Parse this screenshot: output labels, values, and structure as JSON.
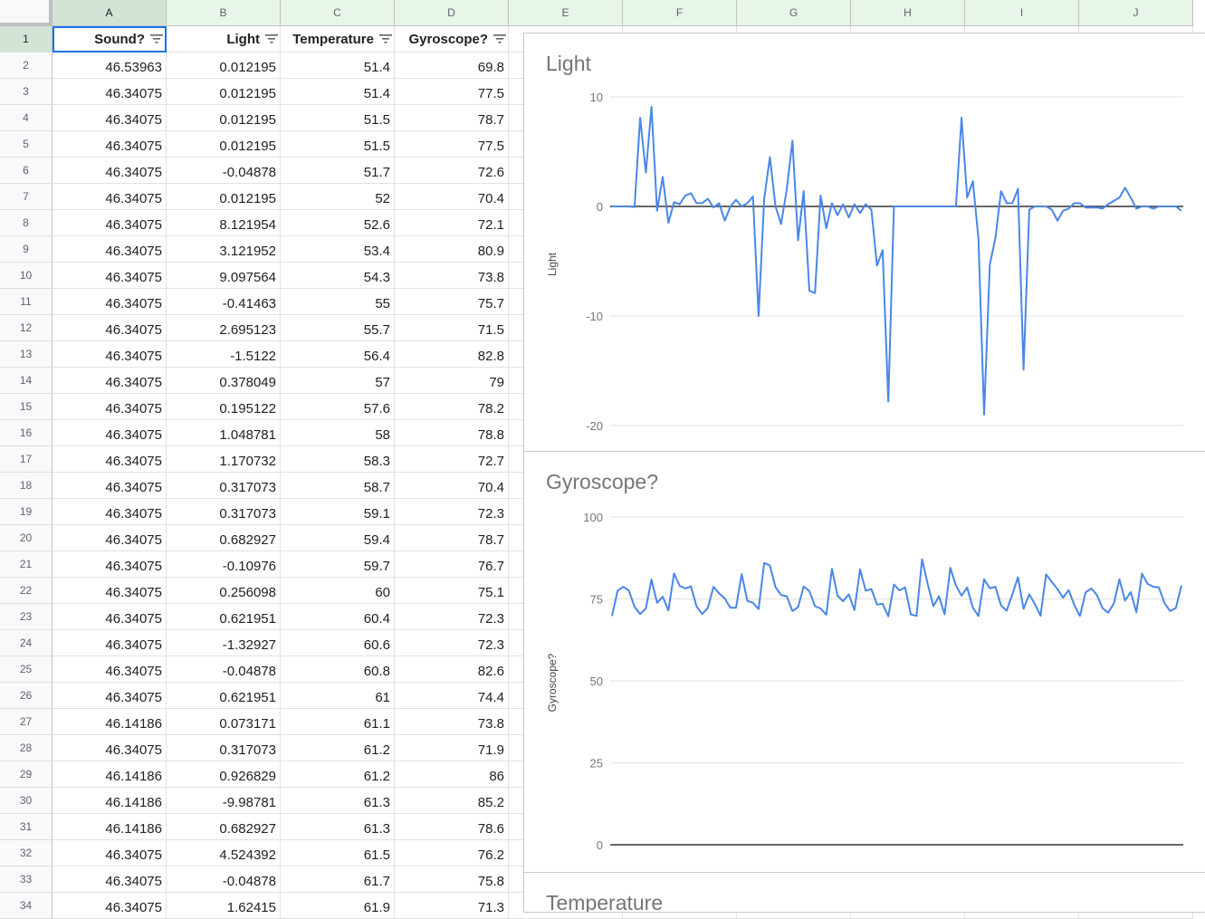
{
  "columns": [
    "A",
    "B",
    "C",
    "D",
    "E",
    "F",
    "G",
    "H",
    "I",
    "J"
  ],
  "headers": {
    "A": "Sound?",
    "B": "Light",
    "C": "Temperature",
    "D": "Gyroscope?"
  },
  "rows": [
    {
      "n": "1"
    },
    {
      "n": "2",
      "a": "46.53963",
      "b": "0.012195",
      "c": "51.4",
      "d": "69.8"
    },
    {
      "n": "3",
      "a": "46.34075",
      "b": "0.012195",
      "c": "51.4",
      "d": "77.5"
    },
    {
      "n": "4",
      "a": "46.34075",
      "b": "0.012195",
      "c": "51.5",
      "d": "78.7"
    },
    {
      "n": "5",
      "a": "46.34075",
      "b": "0.012195",
      "c": "51.5",
      "d": "77.5"
    },
    {
      "n": "6",
      "a": "46.34075",
      "b": "-0.04878",
      "c": "51.7",
      "d": "72.6"
    },
    {
      "n": "7",
      "a": "46.34075",
      "b": "0.012195",
      "c": "52",
      "d": "70.4"
    },
    {
      "n": "8",
      "a": "46.34075",
      "b": "8.121954",
      "c": "52.6",
      "d": "72.1"
    },
    {
      "n": "9",
      "a": "46.34075",
      "b": "3.121952",
      "c": "53.4",
      "d": "80.9"
    },
    {
      "n": "10",
      "a": "46.34075",
      "b": "9.097564",
      "c": "54.3",
      "d": "73.8"
    },
    {
      "n": "11",
      "a": "46.34075",
      "b": "-0.41463",
      "c": "55",
      "d": "75.7"
    },
    {
      "n": "12",
      "a": "46.34075",
      "b": "2.695123",
      "c": "55.7",
      "d": "71.5"
    },
    {
      "n": "13",
      "a": "46.34075",
      "b": "-1.5122",
      "c": "56.4",
      "d": "82.8"
    },
    {
      "n": "14",
      "a": "46.34075",
      "b": "0.378049",
      "c": "57",
      "d": "79"
    },
    {
      "n": "15",
      "a": "46.34075",
      "b": "0.195122",
      "c": "57.6",
      "d": "78.2"
    },
    {
      "n": "16",
      "a": "46.34075",
      "b": "1.048781",
      "c": "58",
      "d": "78.8"
    },
    {
      "n": "17",
      "a": "46.34075",
      "b": "1.170732",
      "c": "58.3",
      "d": "72.7"
    },
    {
      "n": "18",
      "a": "46.34075",
      "b": "0.317073",
      "c": "58.7",
      "d": "70.4"
    },
    {
      "n": "19",
      "a": "46.34075",
      "b": "0.317073",
      "c": "59.1",
      "d": "72.3"
    },
    {
      "n": "20",
      "a": "46.34075",
      "b": "0.682927",
      "c": "59.4",
      "d": "78.7"
    },
    {
      "n": "21",
      "a": "46.34075",
      "b": "-0.10976",
      "c": "59.7",
      "d": "76.7"
    },
    {
      "n": "22",
      "a": "46.34075",
      "b": "0.256098",
      "c": "60",
      "d": "75.1"
    },
    {
      "n": "23",
      "a": "46.34075",
      "b": "0.621951",
      "c": "60.4",
      "d": "72.3"
    },
    {
      "n": "24",
      "a": "46.34075",
      "b": "-1.32927",
      "c": "60.6",
      "d": "72.3"
    },
    {
      "n": "25",
      "a": "46.34075",
      "b": "-0.04878",
      "c": "60.8",
      "d": "82.6"
    },
    {
      "n": "26",
      "a": "46.34075",
      "b": "0.621951",
      "c": "61",
      "d": "74.4"
    },
    {
      "n": "27",
      "a": "46.14186",
      "b": "0.073171",
      "c": "61.1",
      "d": "73.8"
    },
    {
      "n": "28",
      "a": "46.34075",
      "b": "0.317073",
      "c": "61.2",
      "d": "71.9"
    },
    {
      "n": "29",
      "a": "46.14186",
      "b": "0.926829",
      "c": "61.2",
      "d": "86"
    },
    {
      "n": "30",
      "a": "46.14186",
      "b": "-9.98781",
      "c": "61.3",
      "d": "85.2"
    },
    {
      "n": "31",
      "a": "46.14186",
      "b": "0.682927",
      "c": "61.3",
      "d": "78.6"
    },
    {
      "n": "32",
      "a": "46.34075",
      "b": "4.524392",
      "c": "61.5",
      "d": "76.2"
    },
    {
      "n": "33",
      "a": "46.34075",
      "b": "-0.04878",
      "c": "61.7",
      "d": "75.8"
    },
    {
      "n": "34",
      "a": "46.34075",
      "b": "1.62415",
      "c": "61.9",
      "d": "71.3"
    }
  ],
  "colors": {
    "line": "#4a86e8",
    "grid": "#e0e0e0",
    "baseline": "#333333",
    "selection": "#1a73e8"
  },
  "chart_data": [
    {
      "type": "line",
      "title": "Light",
      "ylabel": "Light",
      "xlabel": "",
      "ylim": [
        -20,
        10
      ],
      "yticks": [
        "10",
        "0",
        "-10",
        "-20"
      ],
      "series": [
        {
          "values": [
            0,
            0,
            0,
            0,
            -0.05,
            8.1,
            3.1,
            9.1,
            -0.4,
            2.7,
            -1.5,
            0.4,
            0.2,
            1.0,
            1.2,
            0.3,
            0.3,
            0.7,
            -0.1,
            0.3,
            -1.3,
            0,
            0.6,
            0,
            0.3,
            0.9,
            -9.99,
            0.7,
            4.5,
            0,
            -1.6,
            1.6,
            6.0,
            -3.1,
            1.4,
            -7.7,
            -7.9,
            1.0,
            -2.0,
            0.3,
            -0.8,
            0.2,
            -1.0,
            0.2,
            -0.6,
            0.2,
            -0.3,
            -5.4,
            -4.0,
            -17.8,
            0,
            0,
            0,
            0,
            0,
            0,
            0,
            0,
            0,
            0,
            0,
            0,
            8.1,
            0.8,
            2.3,
            -3.0,
            -19.0,
            -5.3,
            -2.9,
            1.4,
            0.3,
            0.3,
            1.6,
            -14.9,
            -0.3,
            0,
            0,
            0,
            -0.3,
            -1.3,
            -0.4,
            -0.2,
            0.3,
            0.3,
            -0.1,
            -0.1,
            -0.1,
            -0.2,
            0.2,
            0.5,
            0.8,
            1.7,
            0.8,
            -0.2,
            0,
            0,
            -0.2,
            0,
            0,
            0,
            0,
            -0.4
          ]
        }
      ]
    },
    {
      "type": "line",
      "title": "Gyroscope?",
      "ylabel": "Gyroscope?",
      "xlabel": "",
      "ylim": [
        0,
        100
      ],
      "yticks": [
        "100",
        "75",
        "50",
        "25",
        "0"
      ],
      "series": [
        {
          "values": [
            69.8,
            77.5,
            78.7,
            77.5,
            72.6,
            70.4,
            72.1,
            80.9,
            73.8,
            75.7,
            71.5,
            82.8,
            79,
            78.2,
            78.8,
            72.7,
            70.4,
            72.3,
            78.7,
            76.7,
            75.1,
            72.3,
            72.3,
            82.6,
            74.4,
            73.8,
            71.9,
            86,
            85.2,
            78.6,
            76.2,
            75.8,
            71.3,
            72.5,
            78.8,
            77.4,
            72.8,
            72.1,
            70.2,
            84.2,
            76,
            74.3,
            76.4,
            71.6,
            84,
            77.5,
            78,
            73.3,
            73.5,
            69.7,
            79.4,
            77.6,
            78.5,
            70.3,
            69.8,
            87.1,
            79.4,
            72.8,
            75.8,
            70.3,
            84.5,
            79.1,
            76,
            78.5,
            72.3,
            69.8,
            81,
            78.3,
            78.7,
            73,
            71.4,
            76.4,
            81.6,
            72,
            76.4,
            73.4,
            69.9,
            82.5,
            80.2,
            78,
            75.4,
            77.7,
            73.1,
            69.8,
            77,
            78.2,
            76.2,
            72.2,
            70.8,
            73.6,
            81,
            74.5,
            77.1,
            70.9,
            82.7,
            79.6,
            78.7,
            78.5,
            73.7,
            71.3,
            72.2,
            79.1
          ]
        }
      ]
    },
    {
      "type": "line",
      "title": "Temperature"
    }
  ]
}
